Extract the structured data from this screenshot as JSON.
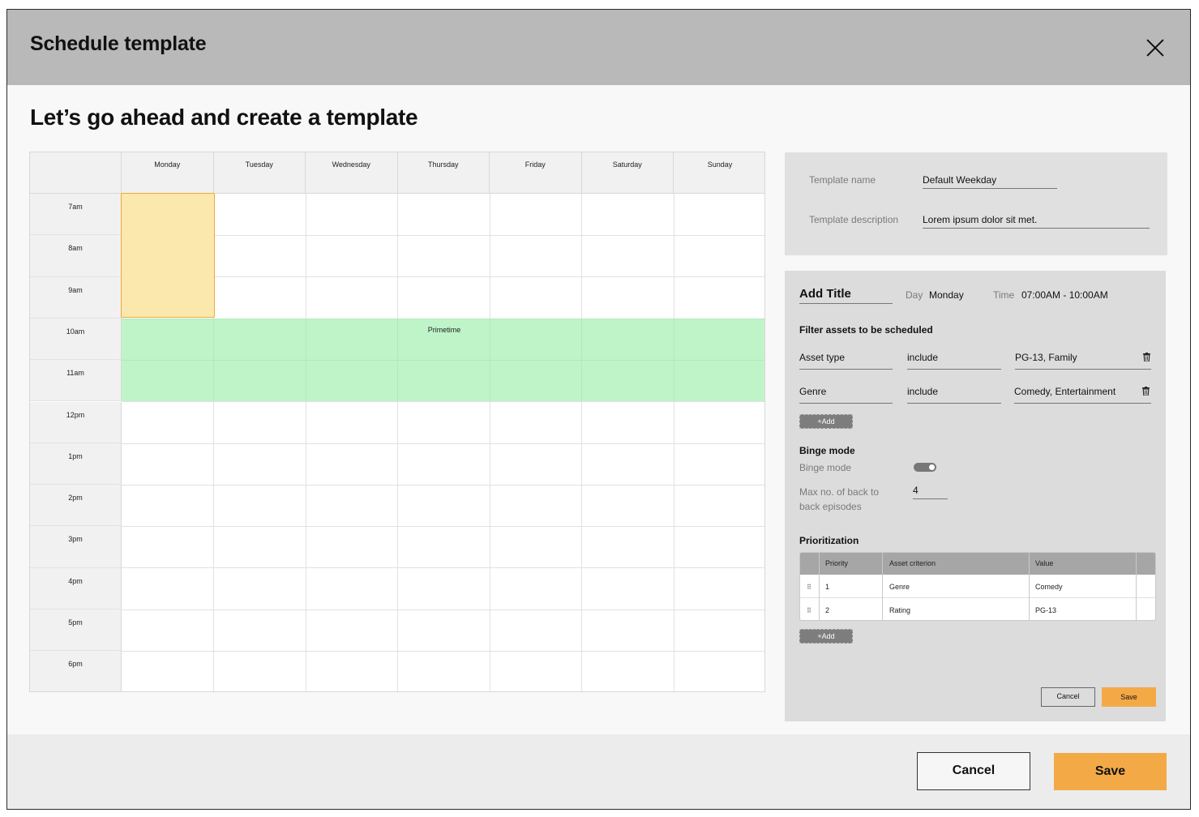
{
  "header": {
    "title": "Schedule template"
  },
  "subtitle": "Let’s go ahead and create a template",
  "calendar": {
    "days": [
      "Monday",
      "Tuesday",
      "Wednesday",
      "Thursday",
      "Friday",
      "Saturday",
      "Sunday"
    ],
    "times": [
      "7am",
      "8am",
      "9am",
      "10am",
      "11am",
      "12pm",
      "1pm",
      "2pm",
      "3pm",
      "4pm",
      "5pm",
      "6pm"
    ],
    "selected_block": {
      "day": "Monday",
      "start": "7am",
      "end": "10am",
      "color": "#fae8ac"
    },
    "primetime_block": {
      "label": "Primetime",
      "start": "10am",
      "end": "12pm",
      "color": "#95eca5"
    }
  },
  "template": {
    "name_label": "Template name",
    "name_value": "Default Weekday",
    "description_label": "Template description",
    "description_value": "Lorem ipsum dolor sit met."
  },
  "editor": {
    "title": "Add Title",
    "day_label": "Day",
    "day_value": "Monday",
    "time_label": "Time",
    "time_value": "07:00AM - 10:00AM",
    "filter_title": "Filter assets to be scheduled",
    "filters": [
      {
        "field": "Asset type",
        "operator": "include",
        "value": "PG-13, Family",
        "icon": "trash-icon"
      },
      {
        "field": "Genre",
        "operator": "include",
        "value": "Comedy, Entertainment",
        "icon": "trash-icon"
      }
    ],
    "add_label": "+Add",
    "binge_title": "Binge mode",
    "binge_label": "Binge mode",
    "binge_enabled": true,
    "max_label_line1": "Max no. of back to",
    "max_label_line2": "back episodes",
    "max_value": "4",
    "prioritization_title": "Prioritization",
    "prio_headers": [
      "Priority",
      "Asset criterion",
      "Value"
    ],
    "prio_rows": [
      {
        "priority": "1",
        "criterion": "Genre",
        "value": "Comedy"
      },
      {
        "priority": "2",
        "criterion": "Rating",
        "value": "PG-13"
      }
    ],
    "prio_add_label": "+Add",
    "cancel_label": "Cancel",
    "save_label": "Save"
  },
  "footer": {
    "cancel_label": "Cancel",
    "save_label": "Save",
    "accent_color": "#f4a947"
  }
}
